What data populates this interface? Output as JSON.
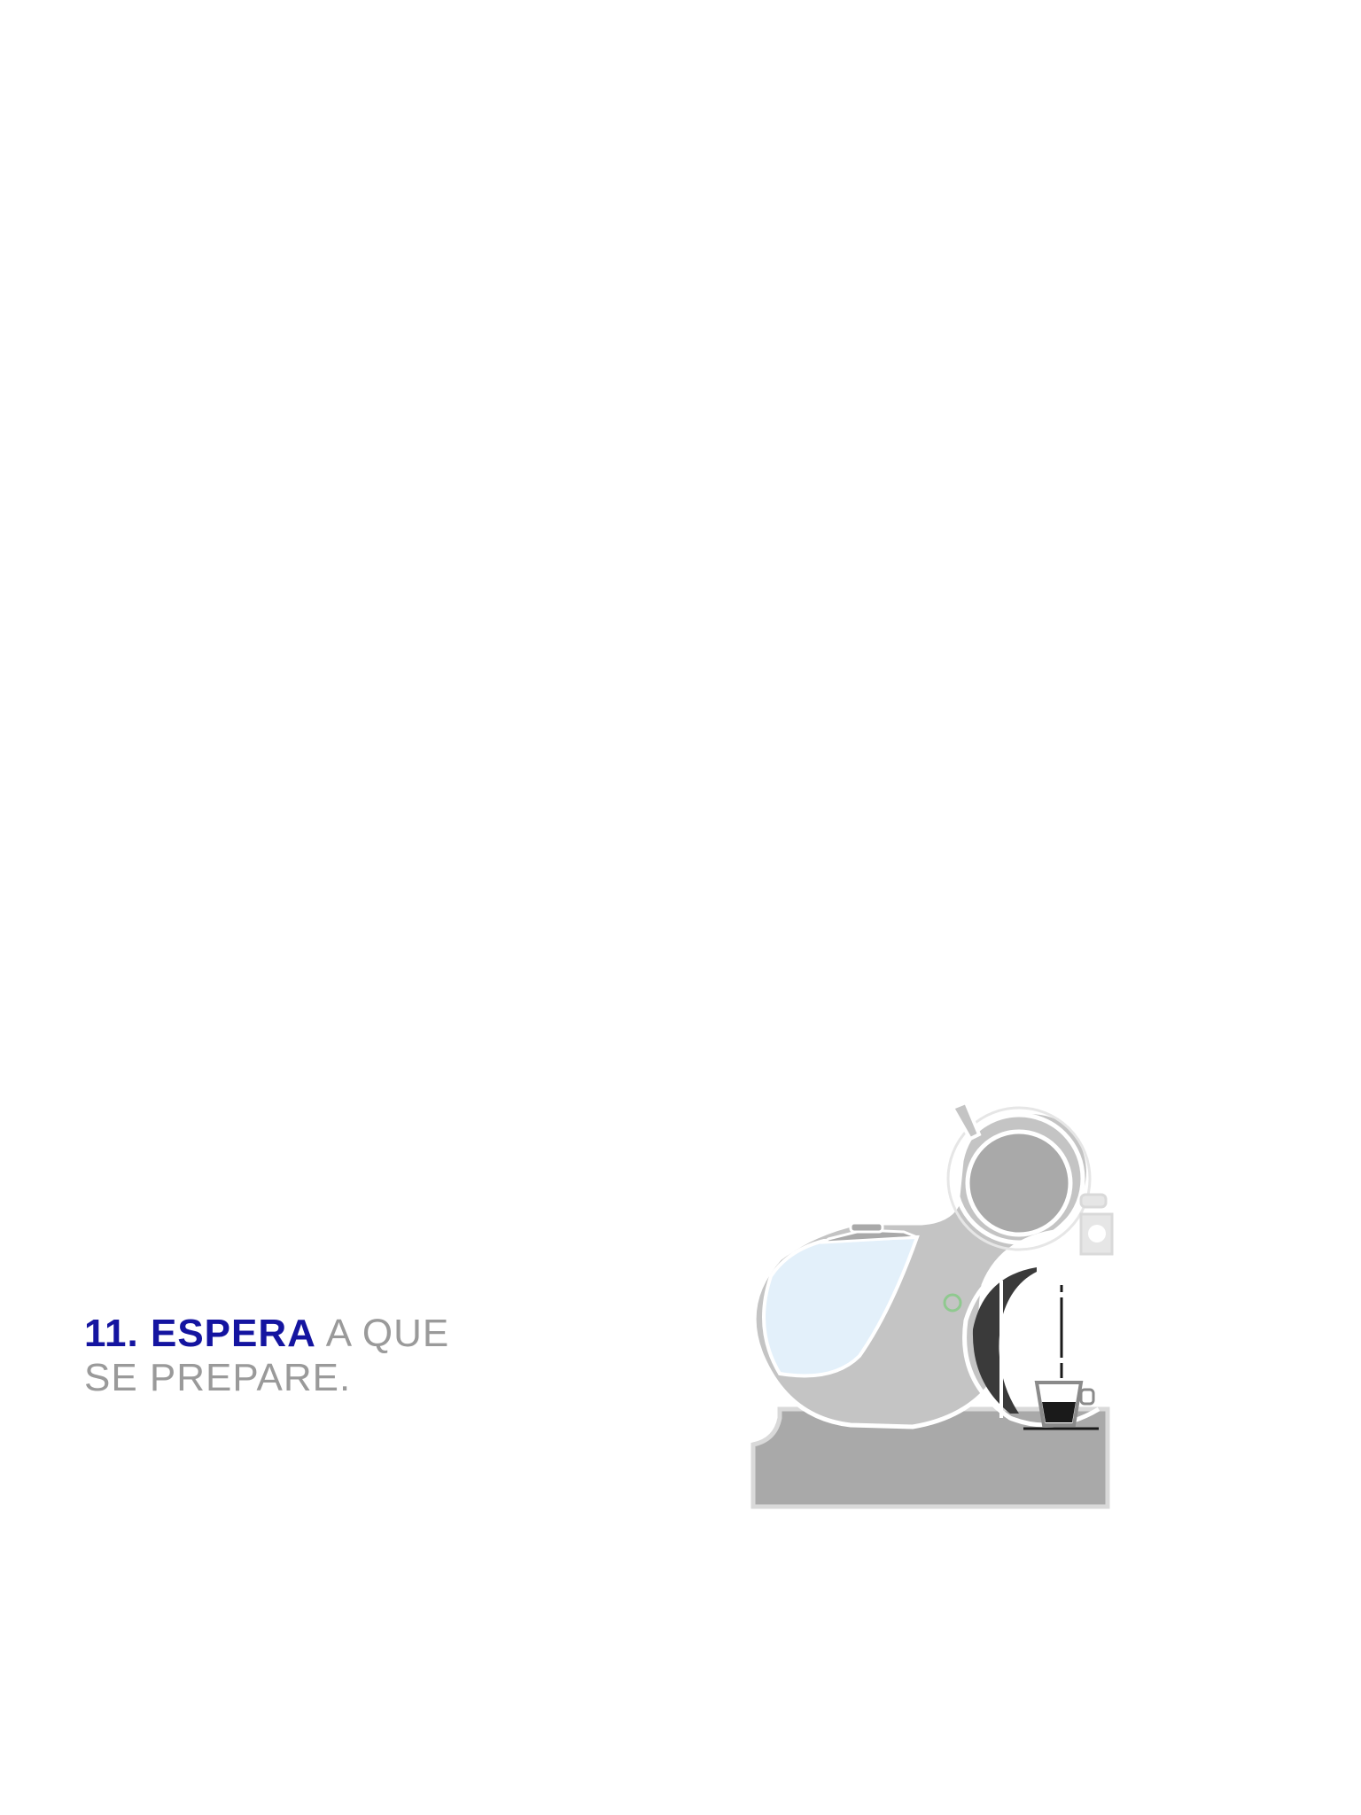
{
  "step": {
    "number": "11.",
    "verb": "ESPERA",
    "rest_line1": "A QUE",
    "rest_line2": "SE PREPARE."
  },
  "illustration": {
    "subject": "coffee-machine-brewing",
    "colors": {
      "accent": "#1414a0",
      "body": "#c4c4c4",
      "body_dark": "#a9a9a9",
      "water_tank": "#e3f0fa",
      "outline": "#ffffff",
      "shadow_line": "#d9d9d9",
      "brew_area": "#1a1a1a",
      "power_led": "#8fc98f"
    }
  }
}
